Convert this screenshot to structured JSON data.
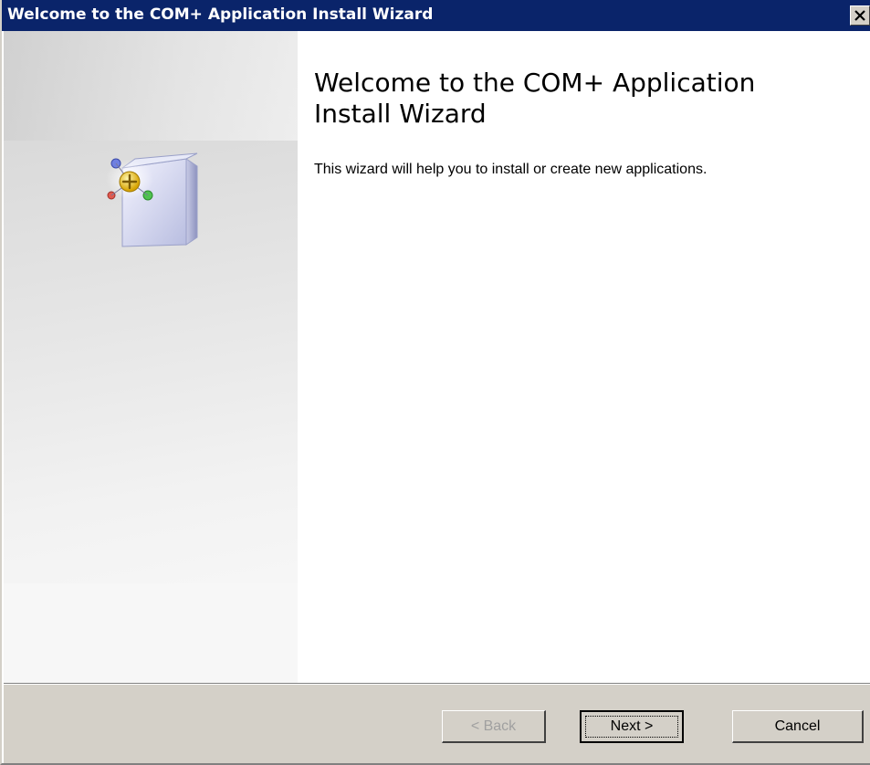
{
  "window": {
    "title": "Welcome to the COM+ Application Install Wizard",
    "close_label": "×"
  },
  "content": {
    "heading": "Welcome to the COM+ Application Install Wizard",
    "description": "This wizard will help you to install or create new applications."
  },
  "buttons": {
    "back": "< Back",
    "next": "Next >",
    "cancel": "Cancel",
    "back_enabled": false
  },
  "icons": {
    "close": "close-icon",
    "wizard": "com-package-icon"
  },
  "colors": {
    "titlebar": "#0a246a",
    "button_face": "#d4d0c8"
  }
}
